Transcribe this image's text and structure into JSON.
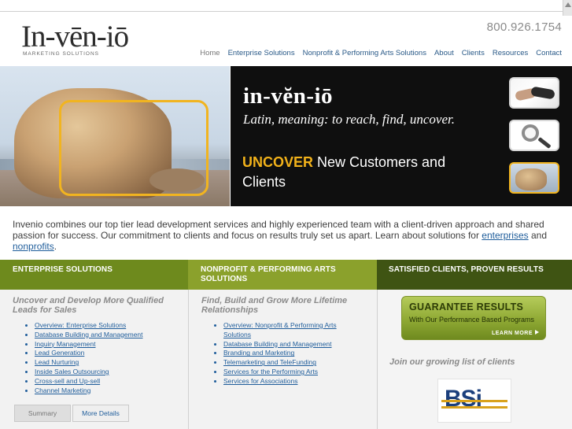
{
  "header": {
    "logo_text": "In-vēn-iō",
    "logo_tagline": "MARKETING SOLUTIONS",
    "phone": "800.926.1754"
  },
  "nav": {
    "items": [
      "Home",
      "Enterprise Solutions",
      "Nonprofit & Performing Arts Solutions",
      "About",
      "Clients",
      "Resources",
      "Contact"
    ],
    "active": "Home"
  },
  "hero": {
    "word": "in-vĕn-iō",
    "definition": "Latin, meaning: to reach, find, uncover.",
    "cta_highlight": "UNCOVER",
    "cta_rest": " New Customers and Clients",
    "highlight_color": "#f2b21a",
    "thumbnails": [
      "handshake-photo",
      "magnifier-photo",
      "rock-photo"
    ]
  },
  "intro": {
    "text_before": "Invenio combines our top tier lead development services and highly experienced team with a client-driven approach and shared passion for success. Our commitment to clients and focus on results truly set us apart. Learn about solutions for ",
    "link_enterprises": "enterprises",
    "text_and": " and ",
    "link_nonprofits": "nonprofits",
    "text_end": "."
  },
  "columns": {
    "enterprise": {
      "heading": "ENTERPRISE SOLUTIONS",
      "subheading": "Uncover and Develop More Qualified Leads for Sales",
      "links": [
        "Overview: Enterprise Solutions",
        "Database Building and Management",
        "Inquiry Management",
        "Lead Generation",
        "Lead Nurturing",
        "Inside Sales Outsourcing",
        "Cross-sell and Up-sell",
        "Channel Marketing"
      ],
      "tabs": [
        "Summary",
        "More Details"
      ],
      "color": "#6e8a1d"
    },
    "nonprofit": {
      "heading": "NONPROFIT & PERFORMING ARTS SOLUTIONS",
      "subheading": "Find, Build and Grow More Lifetime Relationships",
      "links": [
        "Overview: Nonprofit & Performing Arts Solutions",
        "Database Building and Management",
        "Branding and Marketing",
        "Telemarketing and TeleFunding",
        "Services for the Performing Arts",
        "Services for Associations"
      ],
      "color": "#8ba12c"
    },
    "clients": {
      "heading": "SATISFIED CLIENTS, PROVEN RESULTS",
      "guarantee_title": "GUARANTEE RESULTS",
      "guarantee_sub": "With Our Performance Based Programs",
      "guarantee_more": "LEARN MORE",
      "join_text": "Join our growing list of clients",
      "client_logo": "BSi",
      "color": "#3f5413"
    }
  }
}
